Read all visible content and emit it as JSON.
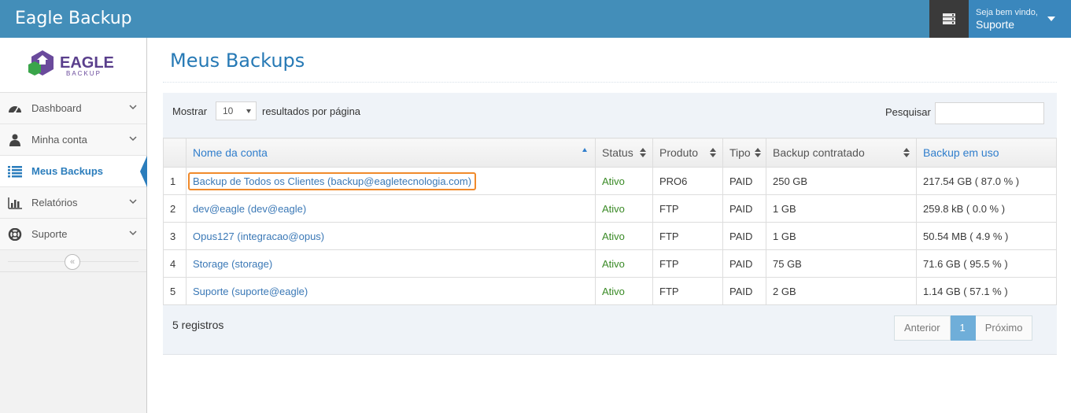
{
  "app": {
    "title": "Eagle Backup"
  },
  "header": {
    "welcome": "Seja bem vindo,",
    "user": "Suporte"
  },
  "logo": {
    "name": "EAGLE",
    "sub": "BACKUP"
  },
  "sidebar": {
    "items": [
      {
        "label": "Dashboard",
        "icon": "dashboard-icon"
      },
      {
        "label": "Minha conta",
        "icon": "user-icon"
      },
      {
        "label": "Meus Backups",
        "icon": "list-icon",
        "active": true
      },
      {
        "label": "Relatórios",
        "icon": "bar-chart-icon"
      },
      {
        "label": "Suporte",
        "icon": "life-ring-icon"
      }
    ],
    "collapse_symbol": "«"
  },
  "page": {
    "title": "Meus Backups"
  },
  "table_controls": {
    "show_label": "Mostrar",
    "page_size": "10",
    "per_page_label": "resultados por página",
    "search_label": "Pesquisar",
    "search_value": ""
  },
  "table": {
    "headers": [
      "",
      "Nome da conta",
      "Status",
      "Produto",
      "Tipo",
      "Backup contratado",
      "Backup em uso"
    ],
    "rows": [
      [
        "1",
        "Backup de Todos os Clientes (backup@eagletecnologia.com)",
        "Ativo",
        "PRO6",
        "PAID",
        "250 GB",
        "217.54 GB ( 87.0 % )"
      ],
      [
        "2",
        "dev@eagle (dev@eagle)",
        "Ativo",
        "FTP",
        "PAID",
        "1 GB",
        "259.8 kB ( 0.0 % )"
      ],
      [
        "3",
        "Opus127 (integracao@opus)",
        "Ativo",
        "FTP",
        "PAID",
        "1 GB",
        "50.54 MB ( 4.9 % )"
      ],
      [
        "4",
        "Storage (storage)",
        "Ativo",
        "FTP",
        "PAID",
        "75 GB",
        "71.6 GB ( 95.5 % )"
      ],
      [
        "5",
        "Suporte (suporte@eagle)",
        "Ativo",
        "FTP",
        "PAID",
        "2 GB",
        "1.14 GB ( 57.1 % )"
      ]
    ]
  },
  "footer": {
    "info": "5 registros",
    "prev": "Anterior",
    "current": "1",
    "next": "Próximo"
  },
  "colors": {
    "header": "#438eb9",
    "accent": "#2679b5",
    "highlight": "#f08a2b",
    "status": "#3a8a26"
  }
}
